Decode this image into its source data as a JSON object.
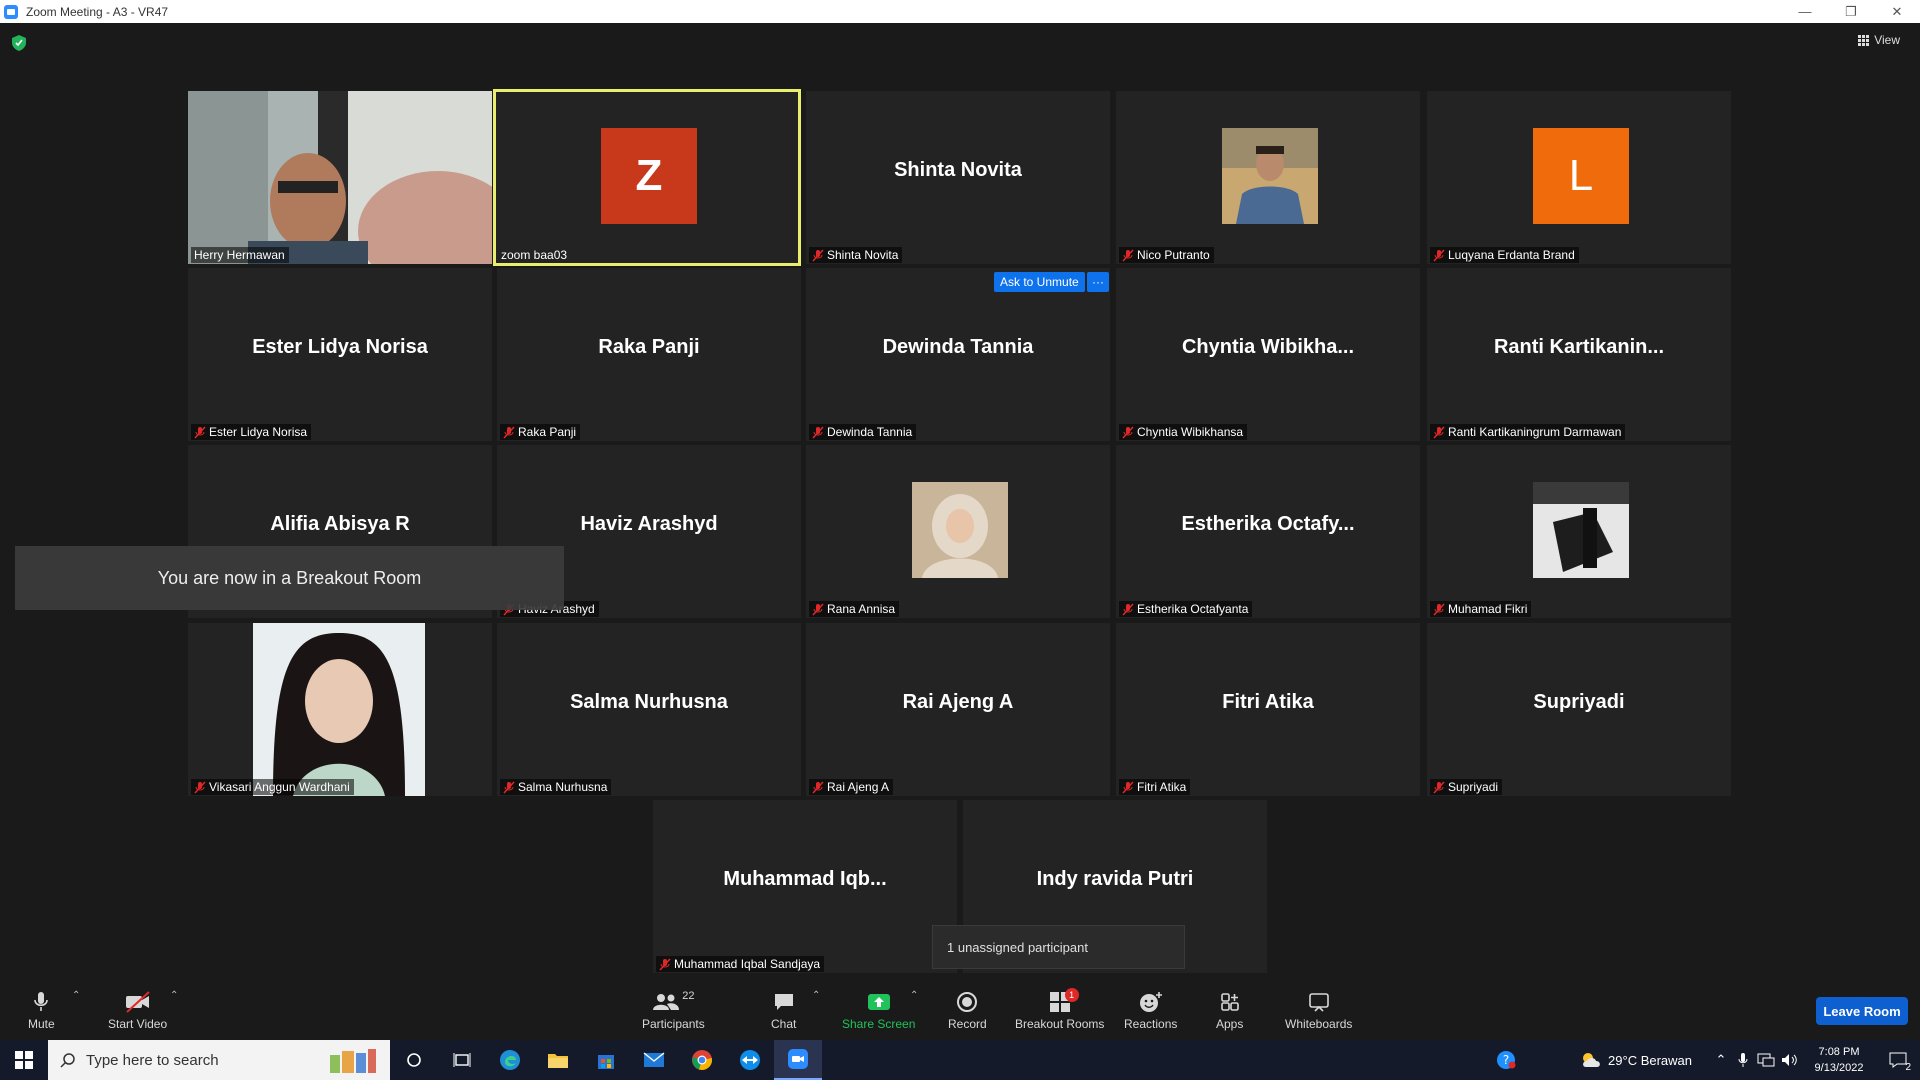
{
  "window": {
    "title": "Zoom Meeting - A3 - VR47"
  },
  "view": {
    "label": "View"
  },
  "tiles": [
    {
      "id": "herry",
      "name": "Herry Hermawan"
    },
    {
      "id": "zoom",
      "name": "zoom baa03",
      "avatar": "Z",
      "avatar_color": "#c8391c"
    },
    {
      "id": "shinta",
      "display": "Shinta Novita",
      "name": "Shinta Novita"
    },
    {
      "id": "nico",
      "name": "Nico Putranto"
    },
    {
      "id": "luqyana",
      "name": "Luqyana Erdanta Brand",
      "avatar": "L",
      "avatar_color": "#f06b0c"
    },
    {
      "id": "ester",
      "display": "Ester Lidya Norisa",
      "name": "Ester Lidya Norisa"
    },
    {
      "id": "raka",
      "display": "Raka Panji",
      "name": "Raka Panji"
    },
    {
      "id": "dewinda",
      "display": "Dewinda Tannia",
      "name": "Dewinda Tannia"
    },
    {
      "id": "chyntia",
      "display": "Chyntia  Wibikha...",
      "name": "Chyntia Wibikhansa"
    },
    {
      "id": "ranti",
      "display": "Ranti  Kartikanin...",
      "name": "Ranti Kartikaningrum Darmawan"
    },
    {
      "id": "alifia",
      "display": "Alifia Abisya R",
      "name": ""
    },
    {
      "id": "haviz",
      "display": "Haviz Arashyd",
      "name": "Haviz Arashyd"
    },
    {
      "id": "rana",
      "name": "Rana Annisa"
    },
    {
      "id": "estherika",
      "display": "Estherika  Octafy...",
      "name": "Estherika Octafyanta"
    },
    {
      "id": "fikri",
      "name": "Muhamad Fikri"
    },
    {
      "id": "vikasari",
      "name": "Vikasari Anggun Wardhani"
    },
    {
      "id": "salma",
      "display": "Salma Nurhusna",
      "name": "Salma Nurhusna"
    },
    {
      "id": "rai",
      "display": "Rai Ajeng A",
      "name": "Rai Ajeng A"
    },
    {
      "id": "fitri",
      "display": "Fitri Atika",
      "name": "Fitri Atika"
    },
    {
      "id": "supriyadi",
      "display": "Supriyadi",
      "name": "Supriyadi"
    },
    {
      "id": "muhammad",
      "display": "Muhammad  Iqb...",
      "name": "Muhammad Iqbal Sandjaya"
    },
    {
      "id": "indy",
      "display": "Indy ravida Putri",
      "name": ""
    }
  ],
  "ask_unmute": "Ask to Unmute",
  "more": "···",
  "toast": "You are now in a Breakout Room",
  "unassigned_tip": "1 unassigned participant",
  "toolbar": {
    "mute": "Mute",
    "start_video": "Start Video",
    "participants": "Participants",
    "participants_count": "22",
    "chat": "Chat",
    "share_screen": "Share Screen",
    "record": "Record",
    "breakout_rooms": "Breakout Rooms",
    "breakout_badge": "1",
    "reactions": "Reactions",
    "apps": "Apps",
    "whiteboards": "Whiteboards",
    "leave": "Leave Room"
  },
  "taskbar": {
    "search_placeholder": "Type here to search",
    "weather": "29°C  Berawan",
    "time": "7:08 PM",
    "date": "9/13/2022",
    "notif_count": "2"
  },
  "colors": {
    "accent": "#0e72ed",
    "speaker_border": "#e9ef6c",
    "share_green": "#21c15b"
  }
}
